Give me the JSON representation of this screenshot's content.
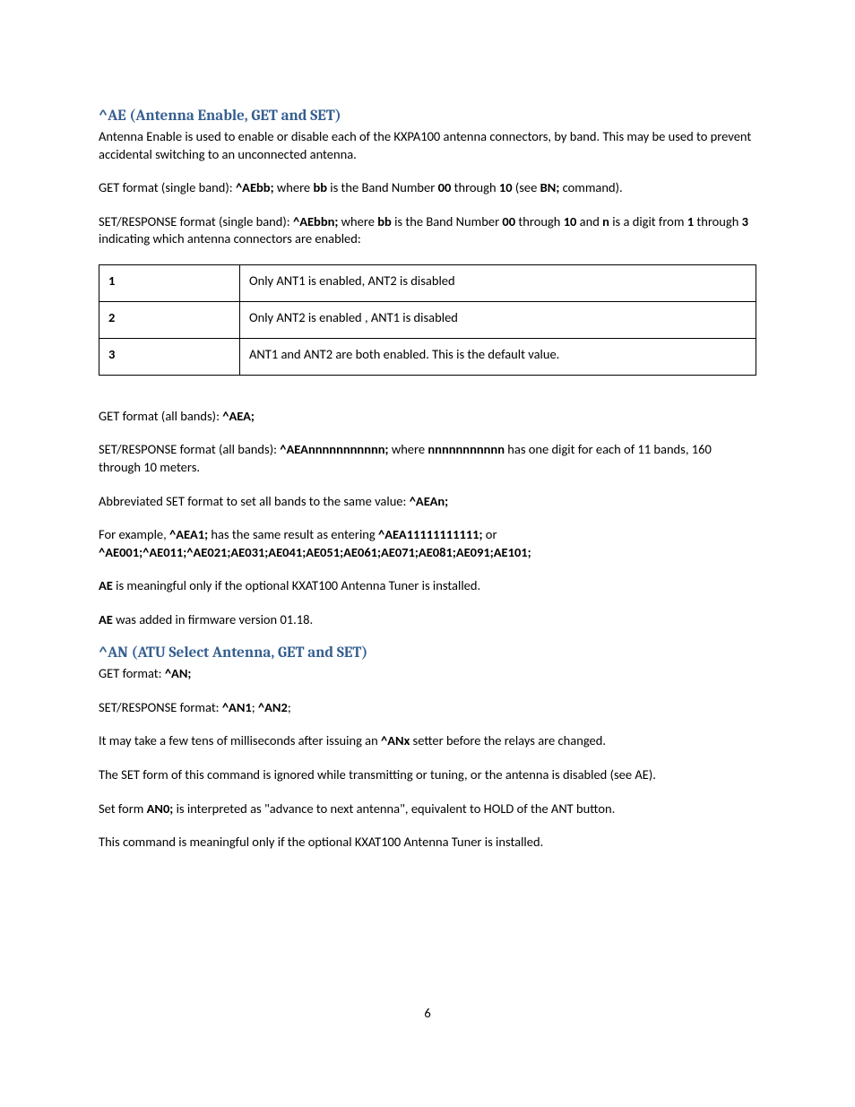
{
  "section1": {
    "heading": "^AE (Antenna Enable, GET and SET)",
    "intro": "Antenna Enable is used to enable or disable each of the KXPA100 antenna connectors, by band. This may be used to prevent accidental switching to an unconnected antenna.",
    "get_single": {
      "prefix": "GET format (single band): ",
      "b1": "^AEbb;",
      "mid1": " where ",
      "b2": "bb",
      "mid2": " is the Band Number ",
      "b3": "00",
      "mid3": " through ",
      "b4": "10",
      "mid4": " (see ",
      "b5": "BN;",
      "suffix": " command)."
    },
    "set_single": {
      "prefix": "SET/RESPONSE format (single band): ",
      "b1": "^AEbbn;",
      "mid1": "  where ",
      "b2": "bb",
      "mid2": " is the Band Number ",
      "b3": "00",
      "mid3": " through ",
      "b4": "10",
      "mid4": " and ",
      "b5": "n",
      "mid5": " is a digit from ",
      "b6": "1",
      "mid6": " through ",
      "b7": "3",
      "suffix": " indicating which antenna connectors are enabled:"
    },
    "table": [
      {
        "n": "1",
        "desc": "Only ANT1 is enabled, ANT2 is disabled"
      },
      {
        "n": "2",
        "desc": "Only ANT2 is enabled , ANT1 is disabled"
      },
      {
        "n": "3",
        "desc": "ANT1 and ANT2 are both enabled. This is the default value."
      }
    ],
    "get_all": {
      "prefix": "GET format (all bands): ",
      "b1": "^AEA;"
    },
    "set_all": {
      "prefix": "SET/RESPONSE format (all bands): ",
      "b1": "^AEAnnnnnnnnnnn;",
      "mid1": " where ",
      "b2": "nnnnnnnnnnn",
      "suffix": " has one digit for each of 11 bands, 160 through 10 meters."
    },
    "abbrev": {
      "prefix": "Abbreviated SET format to set all bands to the same value: ",
      "b1": "^AEAn;"
    },
    "example": {
      "prefix": "For example, ",
      "b1": "^AEA1;",
      "mid1": " has the same result as entering  ",
      "b2": "^AEA11111111111;",
      "mid2": " or ",
      "b3": "^AE001;^AE011;^AE021;AE031;AE041;AE051;AE061;AE071;AE081;AE091;AE101;"
    },
    "note1": {
      "b1": "AE",
      "suffix": " is meaningful only if the optional KXAT100 Antenna Tuner is installed."
    },
    "note2": {
      "b1": "AE",
      "suffix": " was added in firmware version 01.18."
    }
  },
  "section2": {
    "heading": "^AN (ATU Select Antenna, GET and SET)",
    "get": {
      "prefix": "GET format: ",
      "b1": "^AN;"
    },
    "set": {
      "prefix": "SET/RESPONSE format: ",
      "b1": "^AN1",
      "mid1": "; ",
      "b2": "^AN2",
      "suffix": ";"
    },
    "delay": {
      "prefix": "It may take a few tens of milliseconds after issuing an ",
      "b1": "^ANx",
      "suffix": " setter before the relays are changed."
    },
    "ignored": "The SET form of this command is ignored while transmitting or tuning, or the antenna is disabled (see AE).",
    "an0": {
      "prefix": "Set form ",
      "b1": "AN0;",
      "suffix": " is interpreted as \"advance to next antenna\", equivalent to HOLD of the ANT button."
    },
    "note": "This command is meaningful only if the optional KXAT100 Antenna Tuner is installed."
  },
  "page_number": "6"
}
